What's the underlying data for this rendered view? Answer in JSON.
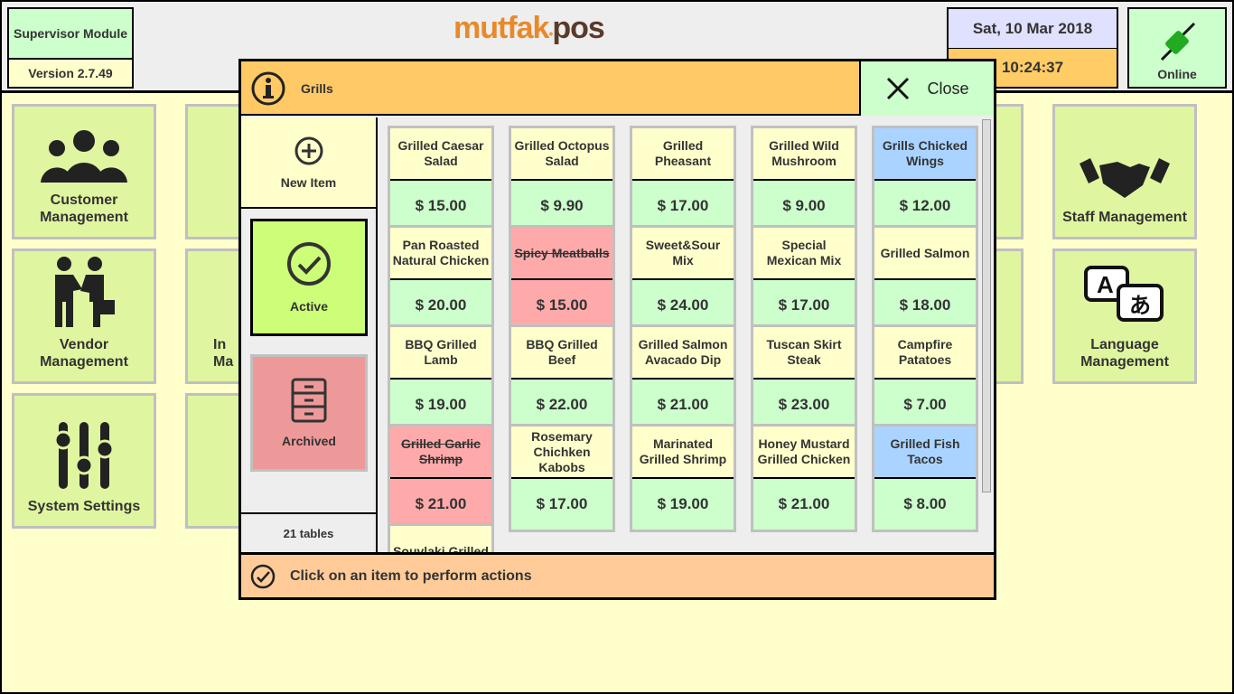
{
  "header": {
    "module": "Supervisor Module",
    "version": "Version 2.7.49",
    "logo": "mutfak pos",
    "date": "Sat, 10 Mar 2018",
    "time": "10:24:37",
    "status": "Online"
  },
  "tiles": [
    {
      "label": "Customer Management",
      "icon": "people-icon"
    },
    {
      "label": "Staff Management",
      "icon": "handshake-icon"
    },
    {
      "label": "Vendor Management",
      "icon": "business-meeting-icon"
    },
    {
      "label": "Language Management",
      "icon": "translate-icon"
    },
    {
      "label": "System Settings",
      "icon": "sliders-icon"
    },
    {
      "label": "Ma",
      "icon": "restaurant-icon"
    },
    {
      "label": "In Ma",
      "icon": "inventory-icon"
    }
  ],
  "modal": {
    "title": "Grills",
    "close": "Close",
    "new_item": "New Item",
    "active": "Active",
    "archived": "Archived",
    "count": "21 tables",
    "footer": "Click on an item to perform actions",
    "items": [
      {
        "name": "Grilled Caesar Salad",
        "price": "$ 15.00",
        "state": "normal"
      },
      {
        "name": "Grilled Octopus Salad",
        "price": "$ 9.90",
        "state": "normal"
      },
      {
        "name": "Grilled Pheasant",
        "price": "$ 17.00",
        "state": "normal"
      },
      {
        "name": "Grilled Wild Mushroom",
        "price": "$ 9.00",
        "state": "normal"
      },
      {
        "name": "Grills Chicked Wings",
        "price": "$ 12.00",
        "state": "highlight"
      },
      {
        "name": "Pan Roasted Natural Chicken",
        "price": "$ 20.00",
        "state": "normal"
      },
      {
        "name": "Spicy Meatballs",
        "price": "$ 15.00",
        "state": "archived"
      },
      {
        "name": "Sweet&Sour Mix",
        "price": "$ 24.00",
        "state": "normal"
      },
      {
        "name": "Special Mexican Mix",
        "price": "$ 17.00",
        "state": "normal"
      },
      {
        "name": "Grilled Salmon",
        "price": "$ 18.00",
        "state": "normal"
      },
      {
        "name": "BBQ Grilled Lamb",
        "price": "$ 19.00",
        "state": "normal"
      },
      {
        "name": "BBQ Grilled Beef",
        "price": "$ 22.00",
        "state": "normal"
      },
      {
        "name": "Grilled Salmon Avacado Dip",
        "price": "$ 21.00",
        "state": "normal"
      },
      {
        "name": "Tuscan Skirt Steak",
        "price": "$ 23.00",
        "state": "normal"
      },
      {
        "name": "Campfire Patatoes",
        "price": "$ 7.00",
        "state": "normal"
      },
      {
        "name": "Grilled Garlic Shrimp",
        "price": "$ 21.00",
        "state": "archived"
      },
      {
        "name": "Rosemary Chichken Kabobs",
        "price": "$ 17.00",
        "state": "normal"
      },
      {
        "name": "Marinated Grilled Shrimp",
        "price": "$ 19.00",
        "state": "normal"
      },
      {
        "name": "Honey Mustard Grilled Chicken",
        "price": "$ 21.00",
        "state": "normal"
      },
      {
        "name": "Grilled Fish Tacos",
        "price": "$ 8.00",
        "state": "highlight"
      },
      {
        "name": "Souvlaki Grilled",
        "price": "",
        "state": "normal"
      }
    ]
  },
  "colors": {
    "normal": "#ffffcc",
    "highlight": "#aad4ff",
    "archived": "#ffaaaa",
    "price": "#ccffcc"
  }
}
